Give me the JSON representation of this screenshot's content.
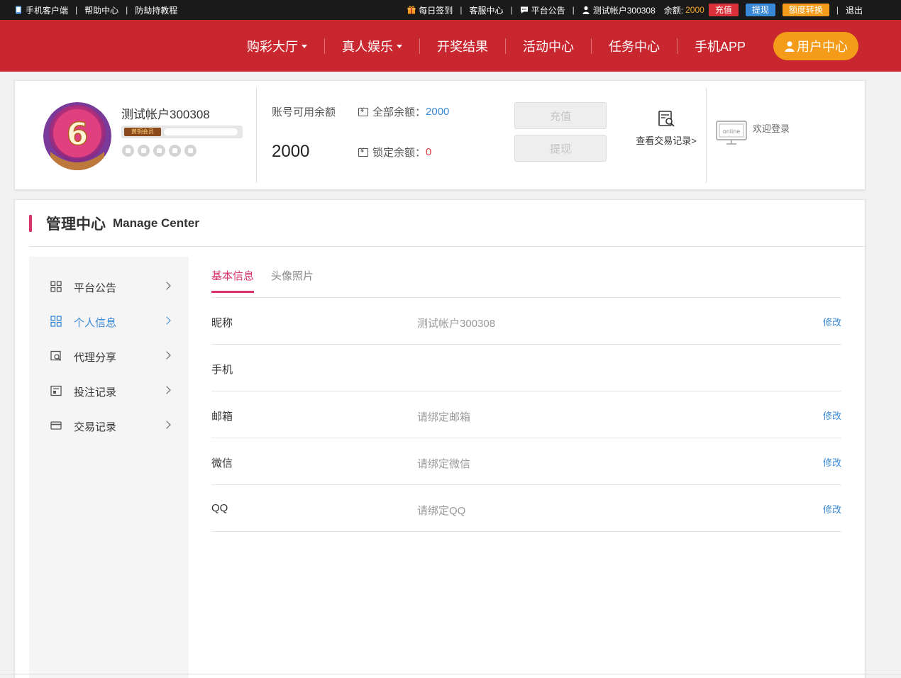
{
  "topbar": {
    "mobile_client": "手机客户端",
    "help_center": "帮助中心",
    "anti_hijack": "防劫持教程",
    "daily_checkin": "每日签到",
    "customer_service": "客服中心",
    "announcement": "平台公告",
    "account_name": "测试帐户300308",
    "balance_label": "余额:",
    "balance_value": "2000",
    "recharge_btn": "充值",
    "withdraw_btn": "提现",
    "transfer_btn": "额度转换",
    "logout": "退出",
    "colors": {
      "recharge": "#d9303a",
      "withdraw": "#3a89d6",
      "transfer": "#f49c1a"
    }
  },
  "nav": {
    "items": [
      {
        "label": "购彩大厅",
        "dropdown": true
      },
      {
        "label": "真人娱乐",
        "dropdown": true
      },
      {
        "label": "开奖结果",
        "dropdown": false
      },
      {
        "label": "活动中心",
        "dropdown": false
      },
      {
        "label": "任务中心",
        "dropdown": false
      },
      {
        "label": "手机APP",
        "dropdown": false
      }
    ],
    "user_center": "用户中心",
    "bg_color": "#c9272f",
    "accent": "#f49c1a"
  },
  "profile": {
    "username": "测试帐户300308",
    "level_badge": "黄铜会员",
    "avatar_digit": "6",
    "available_label": "账号可用余额",
    "available_value": "2000",
    "total_label": "全部余额：",
    "total_value": "2000",
    "locked_label": "锁定余额：",
    "locked_value": "0",
    "recharge_btn": "充值",
    "withdraw_btn": "提现",
    "tx_record": "查看交易记录>",
    "online_text": "online",
    "welcome": "欢迎登录"
  },
  "manage": {
    "title_cn": "管理中心",
    "title_en": "Manage Center",
    "sidebar": [
      {
        "label": "平台公告",
        "icon": "grid-icon",
        "active": false
      },
      {
        "label": "个人信息",
        "icon": "grid-icon",
        "active": true
      },
      {
        "label": "代理分享",
        "icon": "share-icon",
        "active": false
      },
      {
        "label": "投注记录",
        "icon": "bet-record-icon",
        "active": false
      },
      {
        "label": "交易记录",
        "icon": "card-icon",
        "active": false
      }
    ],
    "tabs": [
      {
        "label": "基本信息",
        "active": true
      },
      {
        "label": "头像照片",
        "active": false
      }
    ],
    "rows": [
      {
        "label": "昵称",
        "value": "测试帐户300308",
        "edit": "修改"
      },
      {
        "label": "手机",
        "value": "",
        "edit": ""
      },
      {
        "label": "邮箱",
        "value": "请绑定邮箱",
        "edit": "修改"
      },
      {
        "label": "微信",
        "value": "请绑定微信",
        "edit": "修改"
      },
      {
        "label": "QQ",
        "value": "请绑定QQ",
        "edit": "修改"
      }
    ]
  }
}
